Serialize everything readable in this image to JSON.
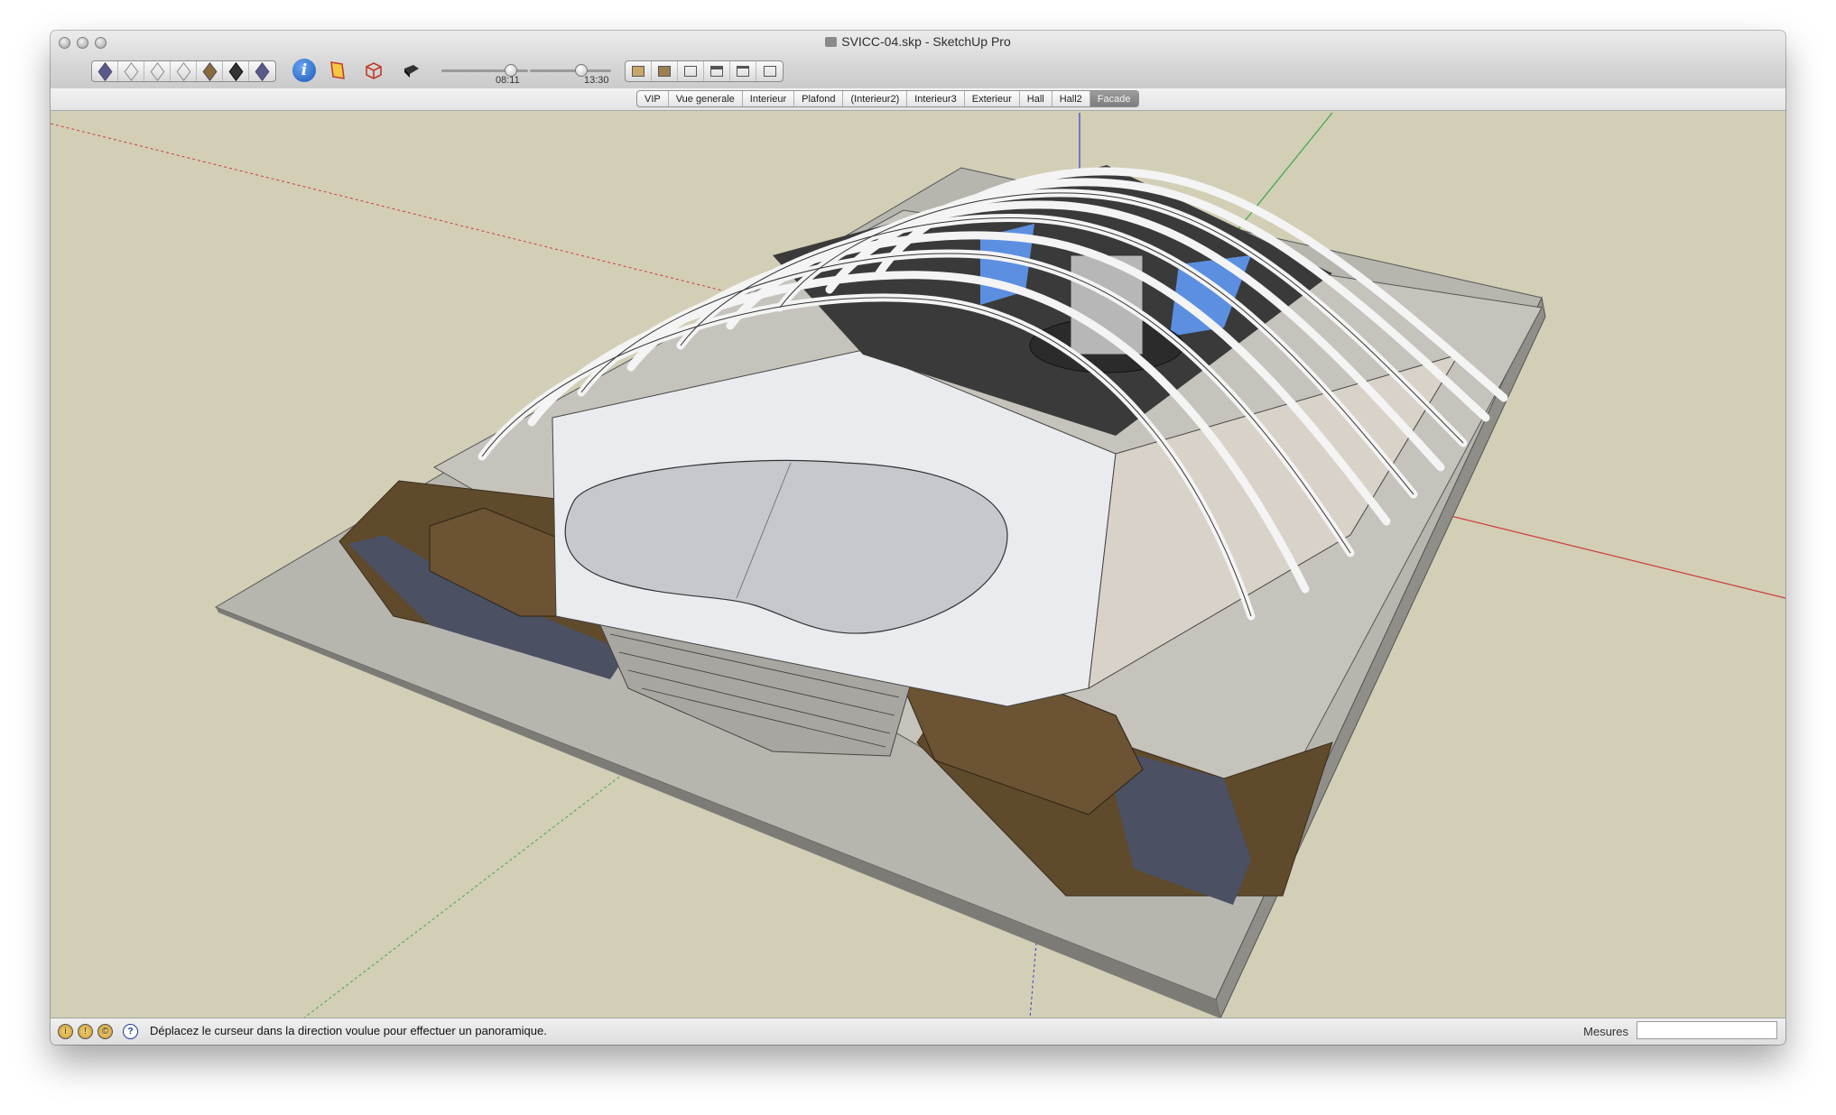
{
  "window": {
    "title": "SVICC-04.skp - SketchUp Pro",
    "controls": [
      "close-button",
      "minimize-button",
      "zoom-button"
    ]
  },
  "toolbar": {
    "view_buttons": [
      "iso-icon",
      "top-icon",
      "front-icon",
      "right-icon",
      "back-icon",
      "left-icon",
      "bottom-icon"
    ],
    "style_buttons": [
      "xray-icon",
      "wireframe-icon"
    ],
    "shadow_time": "08:11",
    "shadow_date_time": "13:30",
    "scene_buttons": [
      "house-icon-1",
      "house-icon-2",
      "house-icon-3",
      "house-icon-4",
      "house-icon-5",
      "house-icon-6"
    ]
  },
  "tabs": [
    {
      "label": "VIP",
      "active": false
    },
    {
      "label": "Vue generale",
      "active": false
    },
    {
      "label": "Interieur",
      "active": false
    },
    {
      "label": "Plafond",
      "active": false
    },
    {
      "label": "(Interieur2)",
      "active": false
    },
    {
      "label": "Interieur3",
      "active": false
    },
    {
      "label": "Exterieur",
      "active": false
    },
    {
      "label": "Hall",
      "active": false
    },
    {
      "label": "Hall2",
      "active": false
    },
    {
      "label": "Facade",
      "active": true
    }
  ],
  "status": {
    "hint": "Déplacez le curseur dans la direction voulue pour effectuer un panoramique.",
    "measure_label": "Mesures",
    "measure_value": ""
  },
  "colors": {
    "canvas": "#d2cfb6",
    "slab": "#b9b8b1",
    "wood": "#6b5334",
    "water": "#4b5063",
    "axis_red": "#d23a3a",
    "axis_green": "#3aa84a",
    "axis_blue": "#3a3ad2"
  }
}
